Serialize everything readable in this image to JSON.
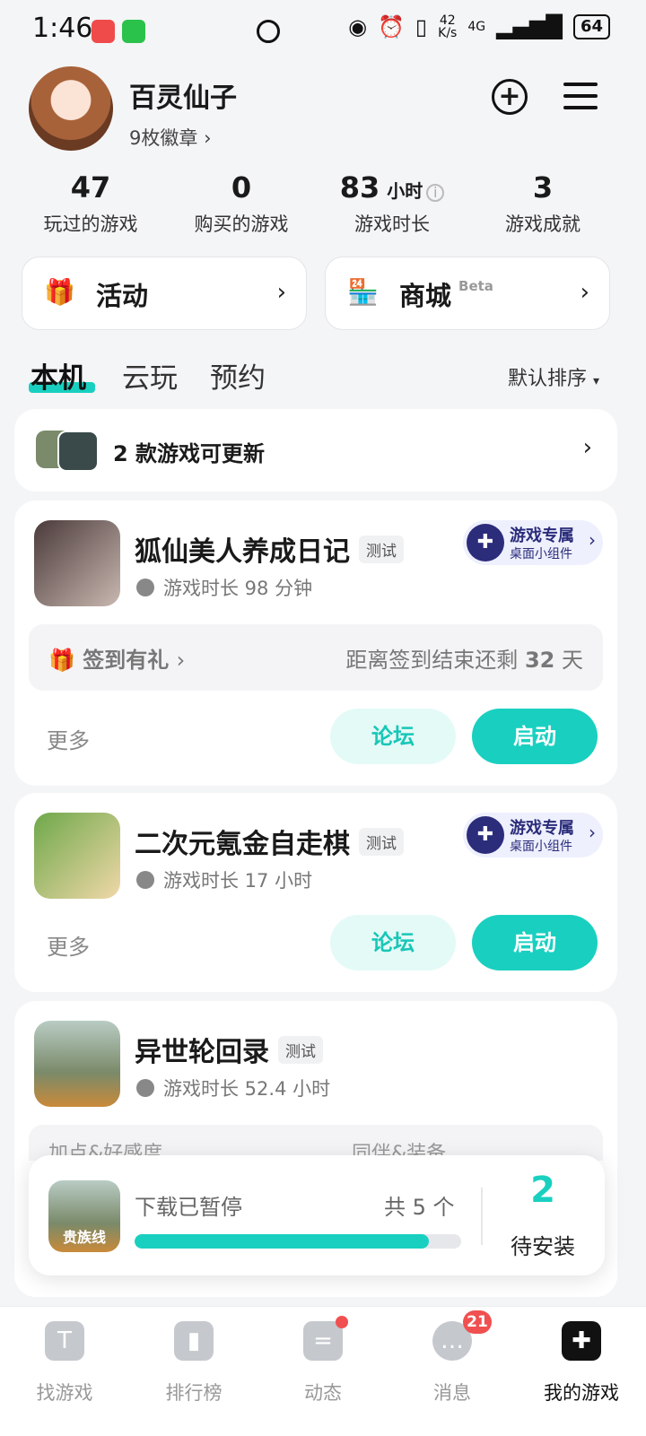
{
  "status_bar": {
    "time": "1:46",
    "net_speed_value": "42",
    "net_speed_unit": "K/s",
    "network": "4G",
    "battery": "64"
  },
  "profile": {
    "name": "百灵仙子",
    "badges": "9枚徽章"
  },
  "stats": [
    {
      "value": "47",
      "unit": "",
      "label": "玩过的游戏"
    },
    {
      "value": "0",
      "unit": "",
      "label": "购买的游戏"
    },
    {
      "value": "83",
      "unit": "小时",
      "label": "游戏时长"
    },
    {
      "value": "3",
      "unit": "",
      "label": "游戏成就"
    }
  ],
  "shortcuts": [
    {
      "label": "活动",
      "icon": "gift-icon"
    },
    {
      "label": "商城",
      "badge": "Beta",
      "icon": "store-icon"
    }
  ],
  "tabs": [
    {
      "label": "本机",
      "active": true
    },
    {
      "label": "云玩",
      "active": false
    },
    {
      "label": "预约",
      "active": false
    }
  ],
  "sort_label": "默认排序",
  "update_banner": {
    "text": "2 款游戏可更新"
  },
  "games": [
    {
      "title": "狐仙美人养成日记",
      "tag": "测试",
      "playtime": "游戏时长 98 分钟",
      "widget_line1": "游戏专属",
      "widget_line2": "桌面小组件",
      "signin_left": "签到有礼",
      "signin_right_prefix": "距离签到结束还剩",
      "signin_days": "32",
      "signin_unit": "天",
      "more": "更多",
      "forum": "论坛",
      "start": "启动"
    },
    {
      "title": "二次元氪金自走棋",
      "tag": "测试",
      "playtime": "游戏时长 17 小时",
      "widget_line1": "游戏专属",
      "widget_line2": "桌面小组件",
      "more": "更多",
      "forum": "论坛",
      "start": "启动"
    },
    {
      "title": "异世轮回录",
      "tag": "测试",
      "playtime": "游戏时长 52.4 小时",
      "faded_left": "加点&好感度",
      "faded_right": "同伴&装备"
    }
  ],
  "download": {
    "status": "下载已暂停",
    "total": "共 5 个",
    "progress": 0.9,
    "count": "2",
    "count_label": "待安装",
    "icon_caption": "贵族线"
  },
  "nav": [
    {
      "label": "找游戏",
      "icon": "find-games-icon"
    },
    {
      "label": "排行榜",
      "icon": "ranking-icon"
    },
    {
      "label": "动态",
      "icon": "feed-icon"
    },
    {
      "label": "消息",
      "icon": "message-icon",
      "badge": "21"
    },
    {
      "label": "我的游戏",
      "icon": "my-games-icon",
      "active": true
    }
  ],
  "colors": {
    "accent": "#19d0c0",
    "widget": "#2b2c7a",
    "badge": "#f05050"
  }
}
